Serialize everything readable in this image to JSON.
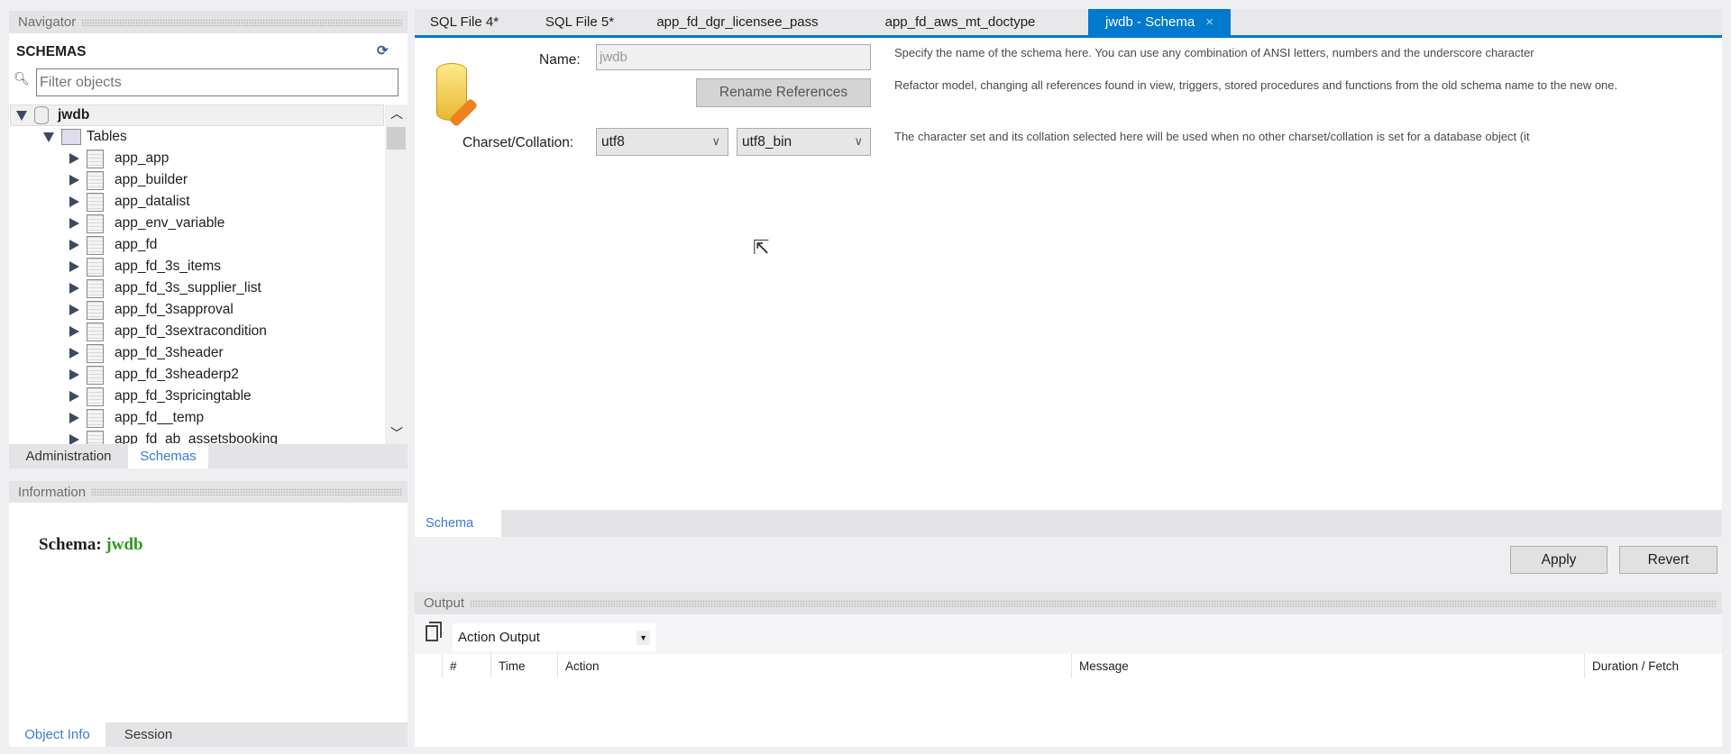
{
  "navigator": {
    "title": "Navigator",
    "schemas_label": "SCHEMAS",
    "filter_placeholder": "Filter objects",
    "tree": {
      "schema": "jwdb",
      "folder": "Tables",
      "tables": [
        "app_app",
        "app_builder",
        "app_datalist",
        "app_env_variable",
        "app_fd",
        "app_fd_3s_items",
        "app_fd_3s_supplier_list",
        "app_fd_3sapproval",
        "app_fd_3sextracondition",
        "app_fd_3sheader",
        "app_fd_3sheaderp2",
        "app_fd_3spricingtable",
        "app_fd__temp",
        "app_fd_ab_assetsbooking"
      ]
    },
    "bottom_tabs": [
      "Administration",
      "Schemas"
    ]
  },
  "information": {
    "title": "Information",
    "schema_label": "Schema:",
    "schema_value": "jwdb",
    "tabs": [
      "Object Info",
      "Session"
    ]
  },
  "editor_tabs": [
    "SQL File 4*",
    "SQL File 5*",
    "app_fd_dgr_licensee_pass",
    "app_fd_aws_mt_doctype",
    "jwdb - Schema"
  ],
  "schema_editor": {
    "name_label": "Name:",
    "name_value": "jwdb",
    "name_desc": "Specify the name of the schema here. You can use any combination of ANSI letters, numbers and the underscore character",
    "rename_button": "Rename References",
    "rename_desc": "Refactor model, changing all references found in view, triggers, stored procedures and functions from the old schema name to the new one.",
    "charset_label": "Charset/Collation:",
    "charset": "utf8",
    "collation": "utf8_bin",
    "charset_desc": "The character set and its collation selected here will be used when no other charset/collation is set for a database object (it",
    "subtab": "Schema",
    "apply": "Apply",
    "revert": "Revert"
  },
  "output": {
    "title": "Output",
    "selector": "Action Output",
    "columns": [
      "#",
      "Time",
      "Action",
      "Message",
      "Duration / Fetch"
    ]
  },
  "colors": {
    "accent": "#007acc",
    "green": "#2e9a1e",
    "link": "#3a7ad4"
  }
}
